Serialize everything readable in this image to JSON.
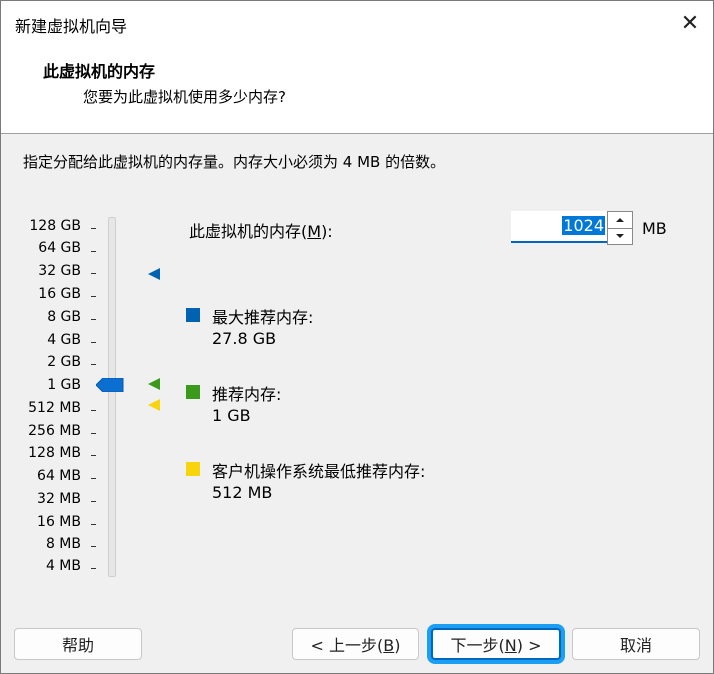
{
  "window": {
    "title": "新建虚拟机向导",
    "close_glyph": "✕"
  },
  "header": {
    "title": "此虚拟机的内存",
    "subtitle": "您要为此虚拟机使用多少内存?"
  },
  "instruction": "指定分配给此虚拟机的内存量。内存大小必须为 4 MB 的倍数。",
  "memory_scale": [
    "128 GB",
    "64 GB",
    "32 GB",
    "16 GB",
    "8 GB",
    "4 GB",
    "2 GB",
    "1 GB",
    "512 MB",
    "256 MB",
    "128 MB",
    "64 MB",
    "32 MB",
    "16 MB",
    "8 MB",
    "4 MB"
  ],
  "slider": {
    "selected_value": "1 GB"
  },
  "memory": {
    "label_prefix": "此虚拟机的内存(",
    "label_key": "M",
    "label_suffix": "):",
    "value": "1024",
    "unit": "MB"
  },
  "legend": [
    {
      "title": "最大推荐内存:",
      "value": "27.8 GB",
      "color": "#0063b1"
    },
    {
      "title": "推荐内存:",
      "value": "1 GB",
      "color": "#3a9a1c"
    },
    {
      "title": "客户机操作系统最低推荐内存:",
      "value": "512 MB",
      "color": "#f7d40c"
    }
  ],
  "buttons": {
    "help": "帮助",
    "back_prefix": "< 上一步(",
    "back_key": "B",
    "back_suffix": ")",
    "next_prefix": "下一步(",
    "next_key": "N",
    "next_suffix": ") >",
    "cancel": "取消"
  },
  "colors": {
    "accent": "#0067c0",
    "focus_ring": "#1aa0f2",
    "selection": "#0078d7",
    "thumb": "#0a6fd1"
  }
}
